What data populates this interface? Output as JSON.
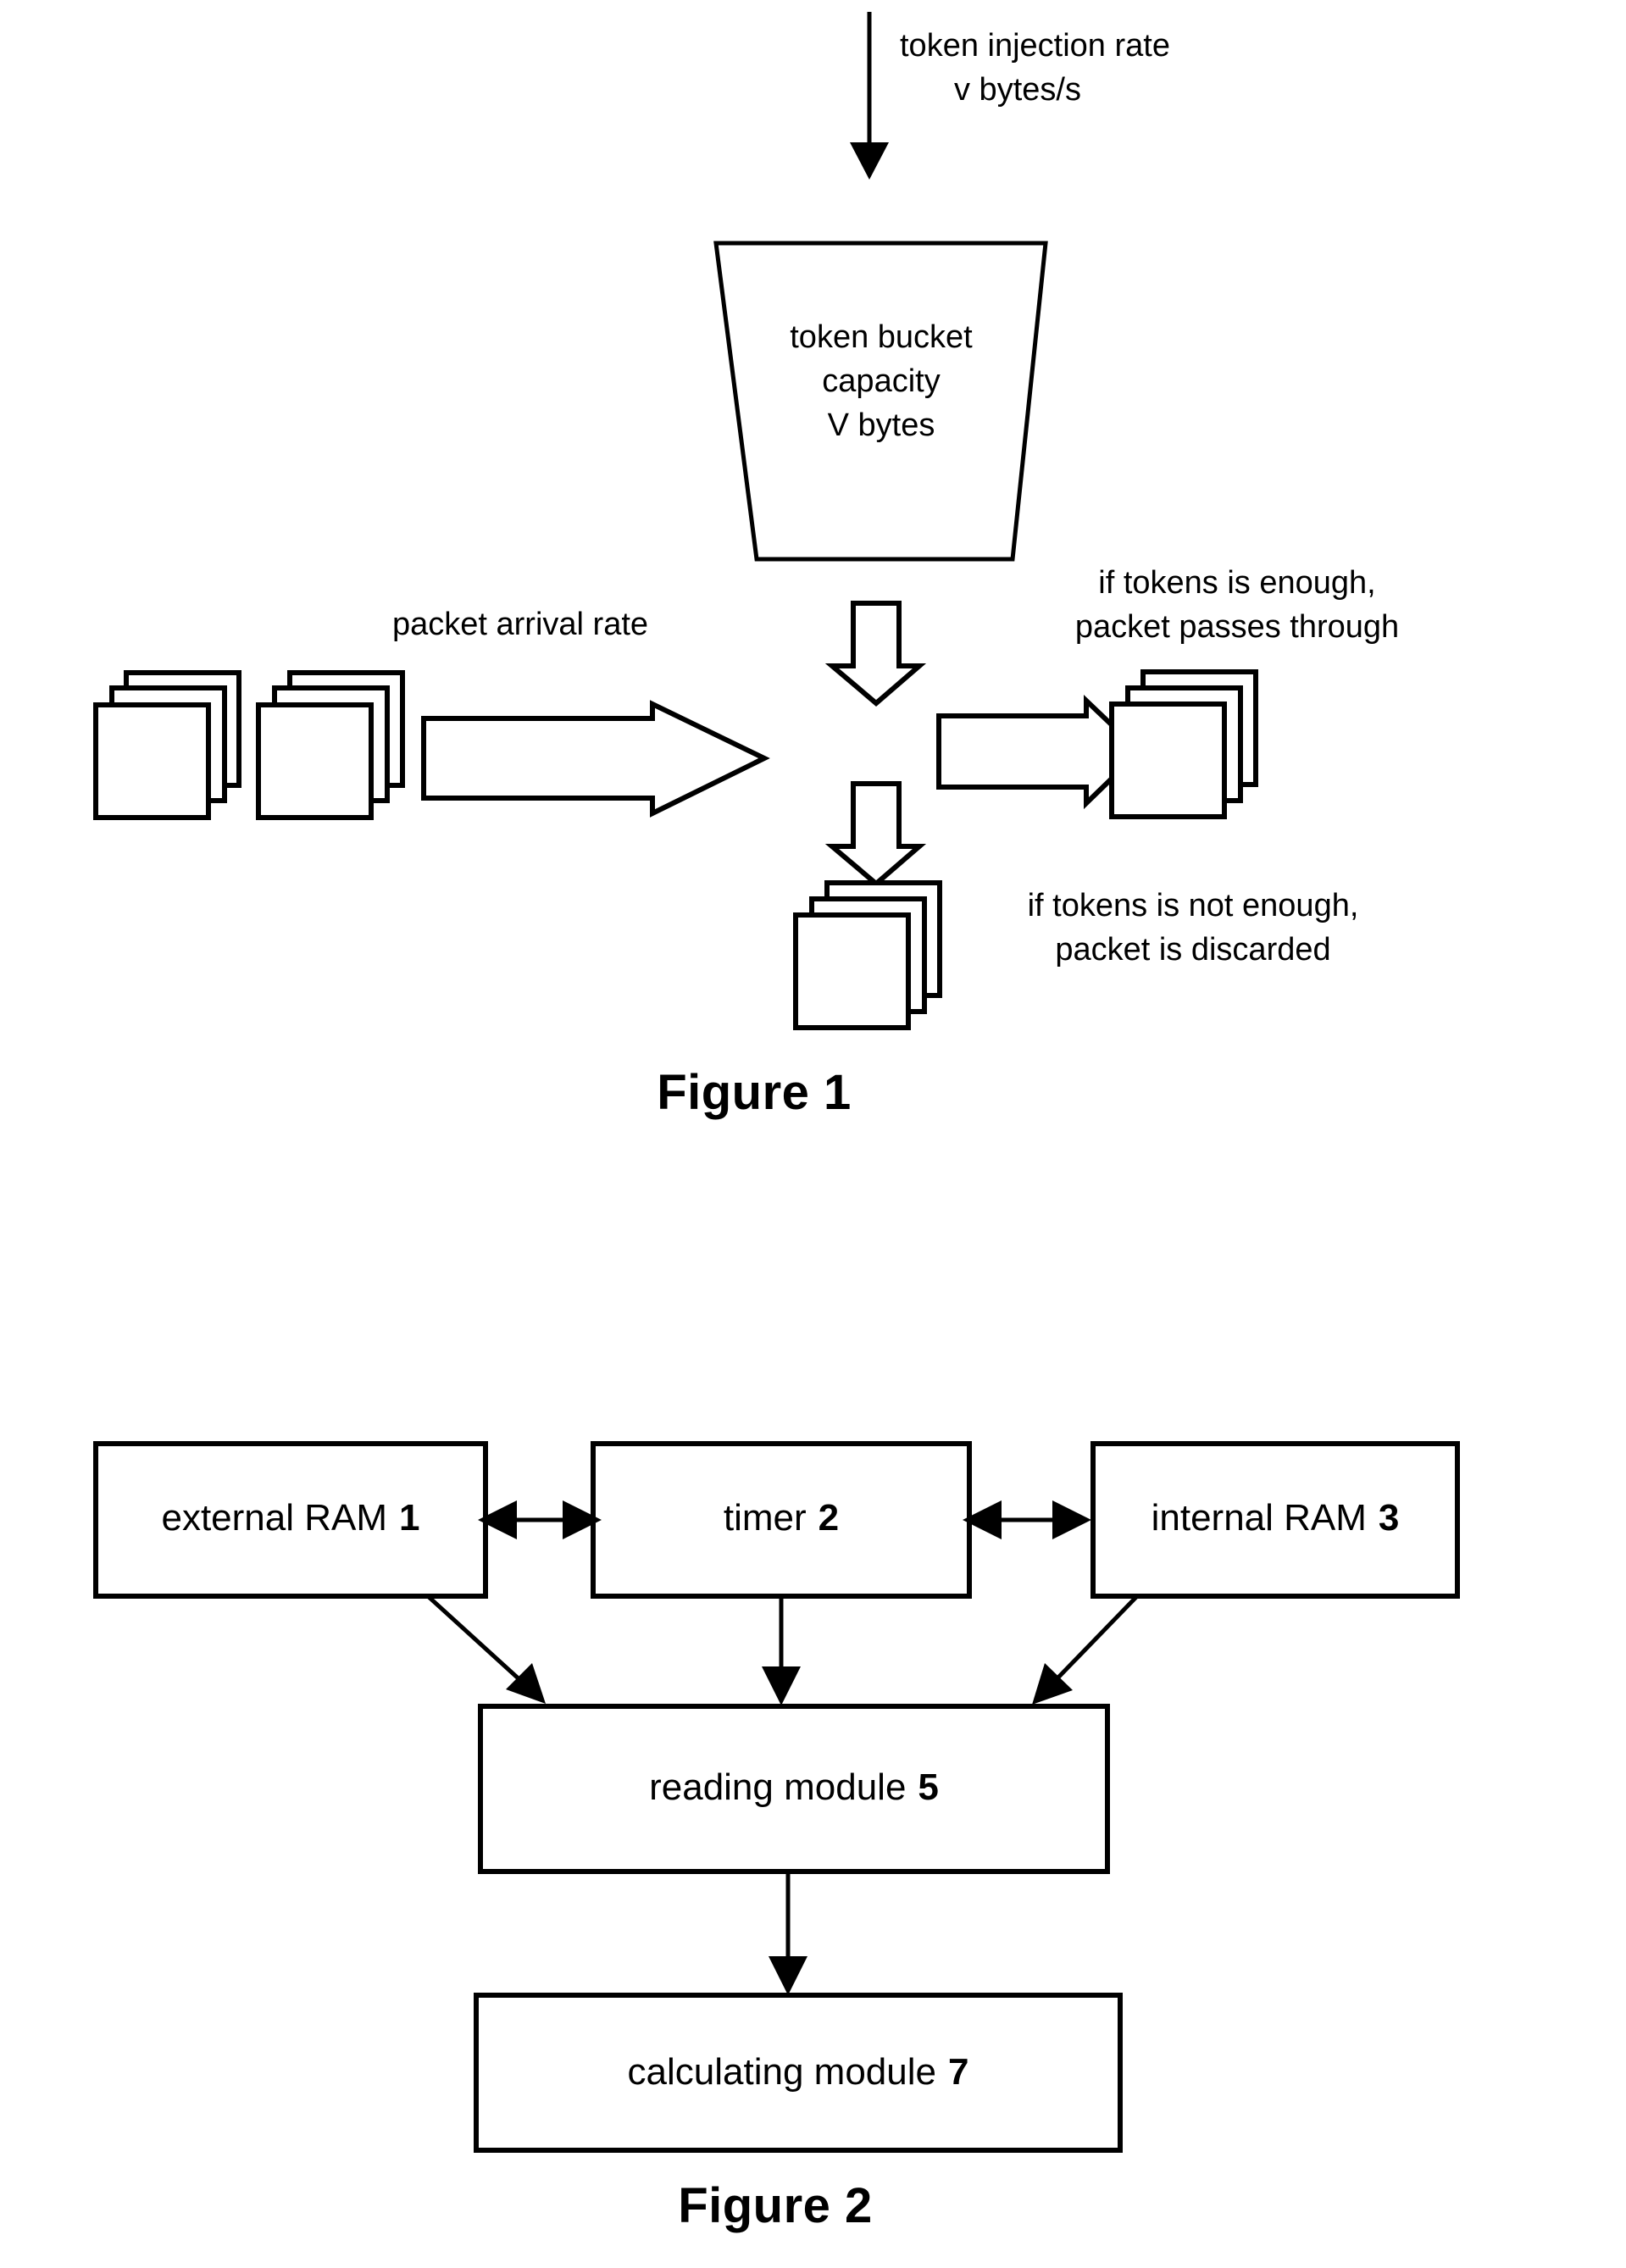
{
  "document": {
    "kind": "patent-figure-sheet",
    "figures": [
      {
        "id": "figure-1",
        "caption": "Figure 1",
        "topLabel": {
          "line1": "token injection rate",
          "line2": "v bytes/s"
        },
        "bucket": {
          "line1": "token bucket",
          "line2": "capacity",
          "line3": "V bytes"
        },
        "arrivalLabel": "packet arrival rate",
        "passLabel": {
          "line1": "if tokens is enough,",
          "line2": "packet passes through"
        },
        "discardLabel": {
          "line1": "if tokens is not enough,",
          "line2": "packet is discarded"
        }
      },
      {
        "id": "figure-2",
        "caption": "Figure 2",
        "boxes": [
          {
            "key": "external-ram",
            "label": "external RAM",
            "ref": "1"
          },
          {
            "key": "timer",
            "label": "timer",
            "ref": "2"
          },
          {
            "key": "internal-ram",
            "label": "internal RAM",
            "ref": "3"
          },
          {
            "key": "reading-module",
            "label": "reading module",
            "ref": "5"
          },
          {
            "key": "calculating-module",
            "label": "calculating module",
            "ref": "7"
          }
        ]
      }
    ]
  },
  "colors": {
    "ink": "#000000",
    "paper": "#ffffff"
  }
}
